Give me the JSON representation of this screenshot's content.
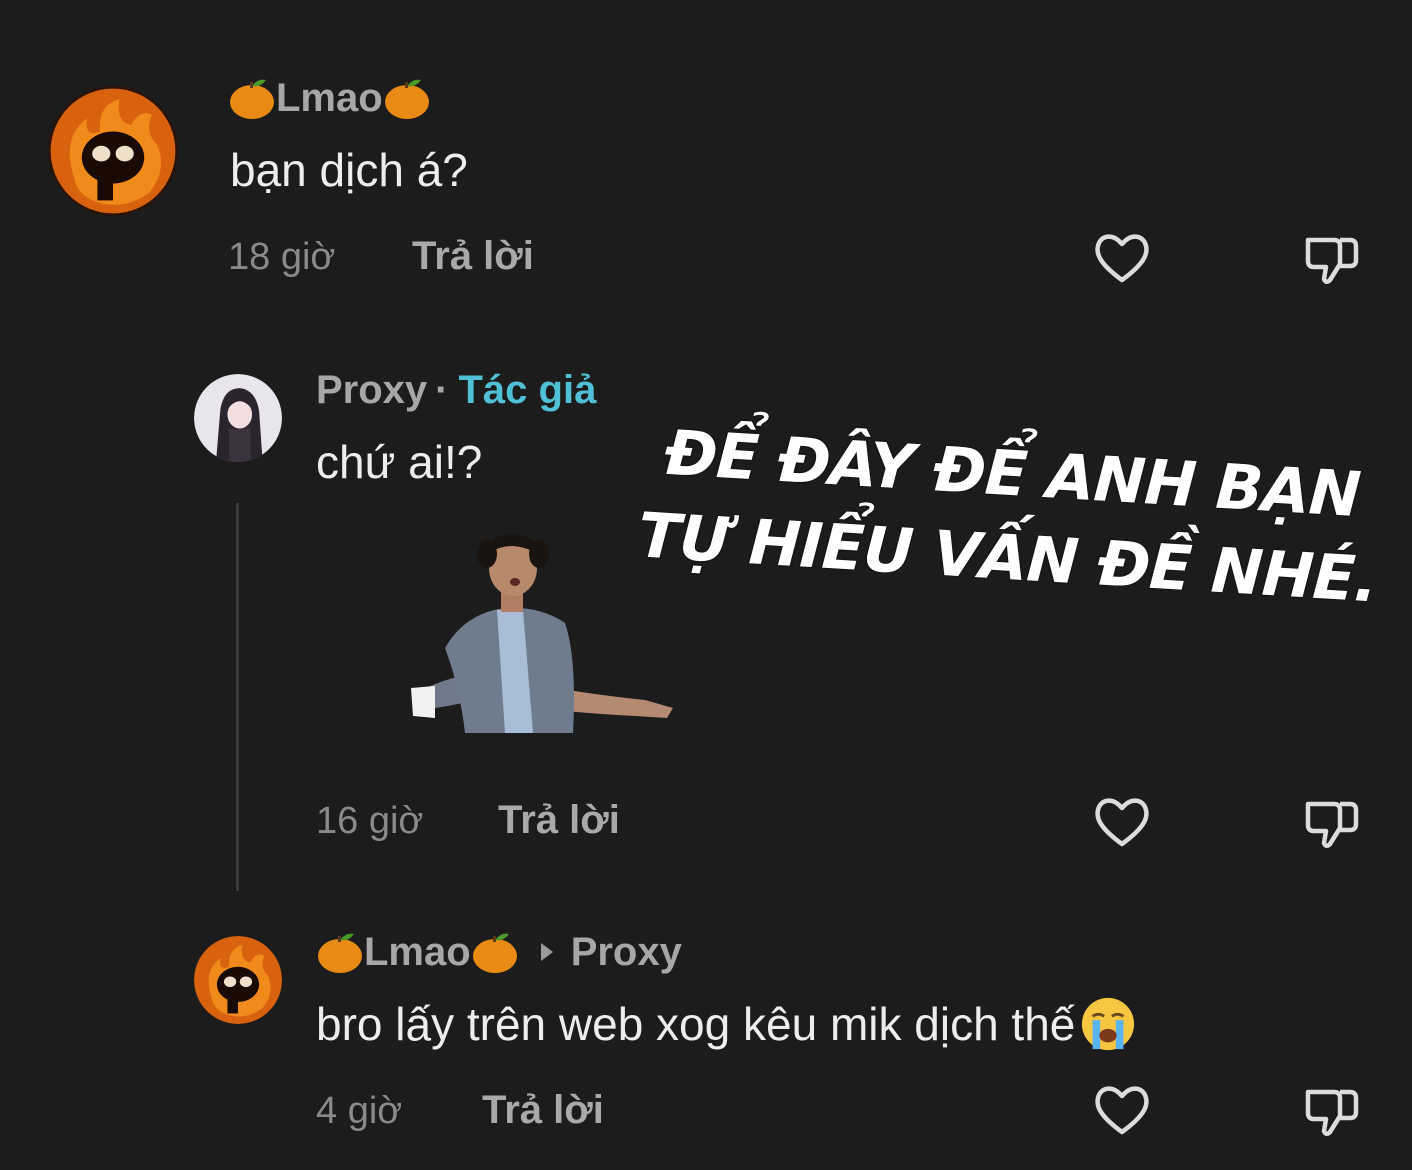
{
  "comments": [
    {
      "author": "Lmao",
      "text": "bạn dịch á?",
      "time": "18 giờ",
      "reply_label": "Trả lời"
    },
    {
      "author": "Proxy",
      "author_separator": "·",
      "author_tag": "Tác giả",
      "text": "chứ ai!?",
      "time": "16 giờ",
      "reply_label": "Trả lời"
    },
    {
      "author": "Lmao",
      "reply_to": "Proxy",
      "text": "bro lấy trên web xog kêu mik dịch thế",
      "time": "4 giờ",
      "reply_label": "Trả lời"
    }
  ],
  "overlay_caption": "ĐỂ ĐÂY ĐỂ ANH BẠN TỰ HIỂU VẤN ĐỀ NHÉ.",
  "icons": {
    "like": "heart-outline-icon",
    "dislike": "thumbs-down-outline-icon",
    "name_decoration": "tangerine-emoji",
    "reply_arrow": "triangle-right-icon",
    "emoji": "loudly-crying-face-emoji"
  },
  "colors": {
    "background": "#1c1c1c",
    "author_tag": "#4fc0d6",
    "text": "#ededed",
    "muted": "#8a8a8a"
  }
}
